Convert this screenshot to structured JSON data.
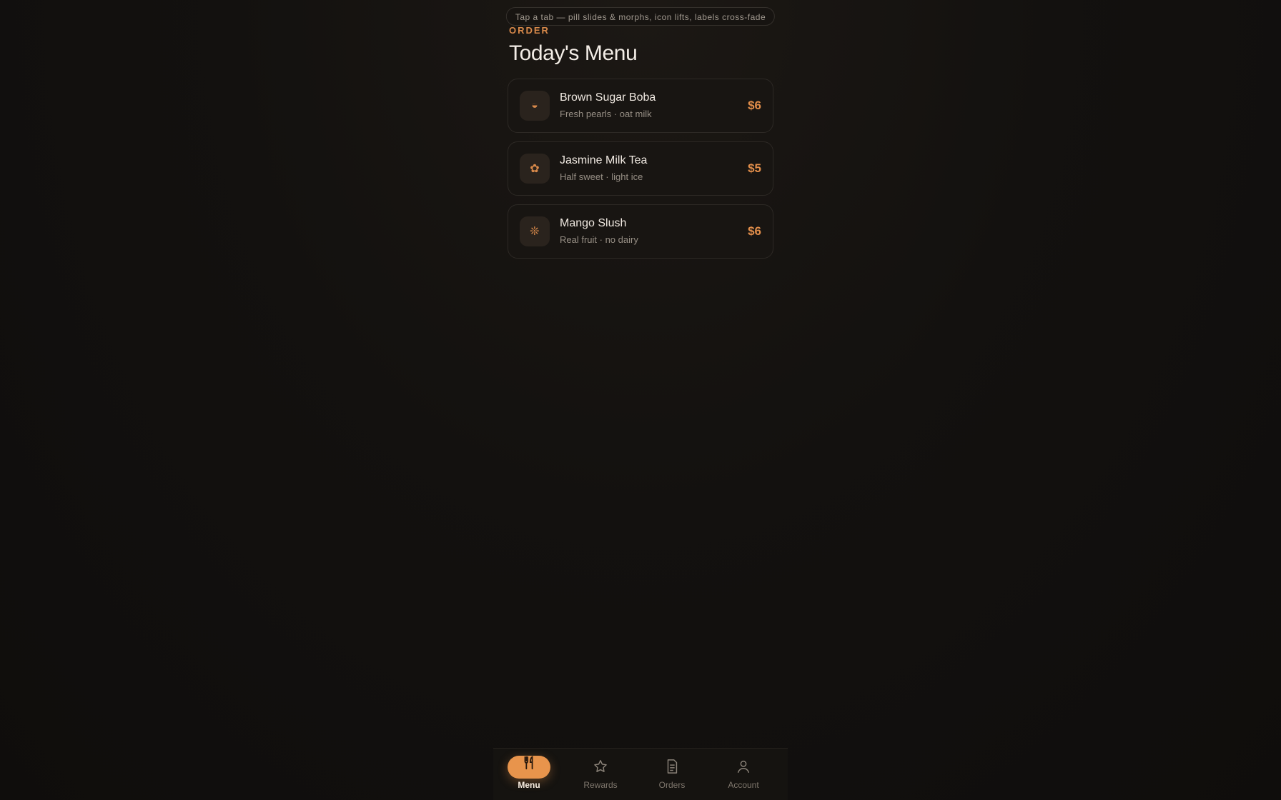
{
  "hint": "Tap a tab — pill slides & morphs, icon lifts, labels cross-fade",
  "header": {
    "eyebrow": "ORDER",
    "title": "Today's Menu"
  },
  "menu": {
    "items": [
      {
        "name": "Brown Sugar Boba",
        "desc": "Fresh pearls · oat milk",
        "price": "$6",
        "icon": "◒",
        "icon_name": "boba-icon"
      },
      {
        "name": "Jasmine Milk Tea",
        "desc": "Half sweet · light ice",
        "price": "$5",
        "icon": "✿",
        "icon_name": "flower-icon"
      },
      {
        "name": "Mango Slush",
        "desc": "Real fruit · no dairy",
        "price": "$6",
        "icon": "❊",
        "icon_name": "sun-icon"
      }
    ]
  },
  "tabs": {
    "active": "menu",
    "items": [
      {
        "label": "Menu",
        "icon": "utensils-icon"
      },
      {
        "label": "Rewards",
        "icon": "star-icon"
      },
      {
        "label": "Orders",
        "icon": "receipt-icon"
      },
      {
        "label": "Account",
        "icon": "user-icon"
      }
    ]
  },
  "colors": {
    "accent": "#e8944c",
    "background": "#110f0d",
    "card": "#181512",
    "text": "#f3ede6",
    "muted": "#978f85"
  }
}
